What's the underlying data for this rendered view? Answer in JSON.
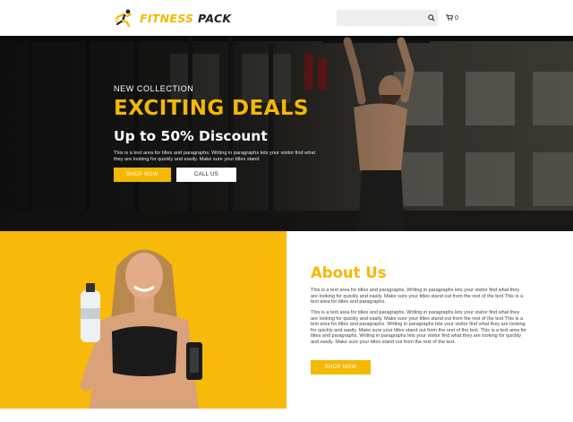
{
  "brand": {
    "name_part1": "FITNESS",
    "name_part2": "PACK",
    "accent_color": "#f5b800"
  },
  "header": {
    "search": {
      "placeholder": "",
      "icon": "search-icon"
    },
    "cart": {
      "icon": "cart-icon",
      "count": "0"
    }
  },
  "hero": {
    "eyebrow": "NEW COLLECTION",
    "title": "EXCITING DEALS",
    "subtitle": "Up to 50% Discount",
    "description": "This is a text area for titles and paragraphs. Writing in paragraphs lets your visitor find what they are looking for quickly and easily. Make sure your titles stand",
    "shop_button": "SHOP NOW",
    "call_button": "CALL US"
  },
  "about": {
    "title": "About Us",
    "paragraph1": "This is a text area for titles and paragraphs. Writing in paragraphs lets your visitor find what they are looking for quickly and easily. Make sure your titles stand out from the rest of the text This is a text area for titles and paragraphs.",
    "paragraph2": "This is a text area for titles and paragraphs. Writing in paragraphs lets your visitor find what they are looking for quickly and easily. Make sure your titles stand out from the rest of the text This is a text area for titles and paragraphs. Writing in paragraphs lets your visitor find what they are looking for quickly and easily. Make sure your titles stand out from the rest of the text. This is a text area for titles and paragraphs. Writing in paragraphs lets your visitor find what they are looking for quickly and easily. Make sure your titles stand out from the rest of the text.",
    "shop_button": "SHOP NOW"
  }
}
